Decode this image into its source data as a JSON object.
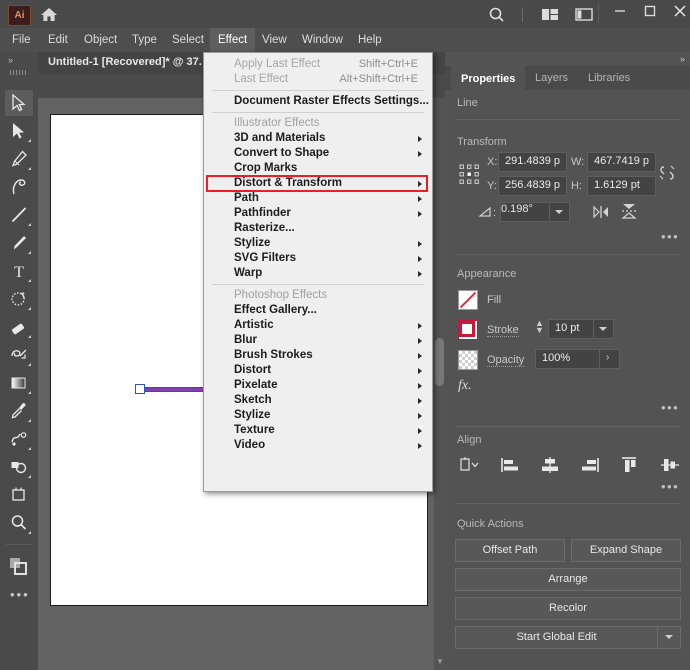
{
  "app": {
    "logo_text": "Ai",
    "home_icon": "home-icon",
    "search_icon": "search-icon",
    "arrange_documents_icon": "arrange-documents-icon",
    "workspace_switcher_icon": "workspace-switcher-icon",
    "minimize_label": "–",
    "maximize_label": "□",
    "close_label": "✕"
  },
  "menubar": {
    "items": [
      {
        "label": "File",
        "active": false
      },
      {
        "label": "Edit",
        "active": false
      },
      {
        "label": "Object",
        "active": false
      },
      {
        "label": "Type",
        "active": false
      },
      {
        "label": "Select",
        "active": false
      },
      {
        "label": "Effect",
        "active": true
      },
      {
        "label": "View",
        "active": false
      },
      {
        "label": "Window",
        "active": false
      },
      {
        "label": "Help",
        "active": false
      }
    ]
  },
  "document": {
    "tab_title": "Untitled-1 [Recovered]* @ 37.",
    "collapse_icon": "»"
  },
  "toolbar": {
    "collapse_icon": "»",
    "edit_toolbar_icon": "•••",
    "tools": [
      {
        "name": "selection-tool",
        "selected": true
      },
      {
        "name": "direct-selection-tool",
        "selected": false
      },
      {
        "name": "pen-tool",
        "selected": false
      },
      {
        "name": "curvature-tool",
        "selected": false
      },
      {
        "name": "line-segment-tool",
        "selected": false
      },
      {
        "name": "paintbrush-tool",
        "selected": false
      },
      {
        "name": "type-tool",
        "selected": false
      },
      {
        "name": "rotate-tool",
        "selected": false
      },
      {
        "name": "eraser-tool",
        "selected": false
      },
      {
        "name": "scale-tool",
        "selected": false
      },
      {
        "name": "gradient-tool",
        "selected": false
      },
      {
        "name": "eyedropper-tool",
        "selected": false
      },
      {
        "name": "blend-tool",
        "selected": false
      },
      {
        "name": "shape-builder-tool",
        "selected": false
      },
      {
        "name": "artboard-tool",
        "selected": false
      },
      {
        "name": "zoom-tool",
        "selected": false
      }
    ]
  },
  "effect_menu": {
    "rows": [
      {
        "kind": "item",
        "label": "Apply Last Effect",
        "shortcut": "Shift+Ctrl+E",
        "disabled": true,
        "submenu": false
      },
      {
        "kind": "item",
        "label": "Last Effect",
        "shortcut": "Alt+Shift+Ctrl+E",
        "disabled": true,
        "submenu": false
      },
      {
        "kind": "separator"
      },
      {
        "kind": "item",
        "label": "Document Raster Effects Settings...",
        "shortcut": "",
        "disabled": false,
        "submenu": false
      },
      {
        "kind": "separator"
      },
      {
        "kind": "header",
        "label": "Illustrator Effects"
      },
      {
        "kind": "item",
        "label": "3D and Materials",
        "shortcut": "",
        "disabled": false,
        "submenu": true
      },
      {
        "kind": "item",
        "label": "Convert to Shape",
        "shortcut": "",
        "disabled": false,
        "submenu": true
      },
      {
        "kind": "item",
        "label": "Crop Marks",
        "shortcut": "",
        "disabled": false,
        "submenu": false
      },
      {
        "kind": "item",
        "label": "Distort & Transform",
        "shortcut": "",
        "disabled": false,
        "submenu": true,
        "highlighted": true
      },
      {
        "kind": "item",
        "label": "Path",
        "shortcut": "",
        "disabled": false,
        "submenu": true
      },
      {
        "kind": "item",
        "label": "Pathfinder",
        "shortcut": "",
        "disabled": false,
        "submenu": true
      },
      {
        "kind": "item",
        "label": "Rasterize...",
        "shortcut": "",
        "disabled": false,
        "submenu": false
      },
      {
        "kind": "item",
        "label": "Stylize",
        "shortcut": "",
        "disabled": false,
        "submenu": true
      },
      {
        "kind": "item",
        "label": "SVG Filters",
        "shortcut": "",
        "disabled": false,
        "submenu": true
      },
      {
        "kind": "item",
        "label": "Warp",
        "shortcut": "",
        "disabled": false,
        "submenu": true
      },
      {
        "kind": "separator"
      },
      {
        "kind": "header",
        "label": "Photoshop Effects"
      },
      {
        "kind": "item",
        "label": "Effect Gallery...",
        "shortcut": "",
        "disabled": false,
        "submenu": false
      },
      {
        "kind": "item",
        "label": "Artistic",
        "shortcut": "",
        "disabled": false,
        "submenu": true
      },
      {
        "kind": "item",
        "label": "Blur",
        "shortcut": "",
        "disabled": false,
        "submenu": true
      },
      {
        "kind": "item",
        "label": "Brush Strokes",
        "shortcut": "",
        "disabled": false,
        "submenu": true
      },
      {
        "kind": "item",
        "label": "Distort",
        "shortcut": "",
        "disabled": false,
        "submenu": true
      },
      {
        "kind": "item",
        "label": "Pixelate",
        "shortcut": "",
        "disabled": false,
        "submenu": true
      },
      {
        "kind": "item",
        "label": "Sketch",
        "shortcut": "",
        "disabled": false,
        "submenu": true
      },
      {
        "kind": "item",
        "label": "Stylize",
        "shortcut": "",
        "disabled": false,
        "submenu": true
      },
      {
        "kind": "item",
        "label": "Texture",
        "shortcut": "",
        "disabled": false,
        "submenu": true
      },
      {
        "kind": "item",
        "label": "Video",
        "shortcut": "",
        "disabled": false,
        "submenu": true
      }
    ],
    "highlight_color": "#ee1c25"
  },
  "properties": {
    "collapse_icon": "»",
    "tabs": [
      {
        "label": "Properties",
        "active": true
      },
      {
        "label": "Layers",
        "active": false
      },
      {
        "label": "Libraries",
        "active": false
      }
    ],
    "selection_label": "Line",
    "transform": {
      "title": "Transform",
      "x_label": "X:",
      "x_value": "291.4839 p",
      "y_label": "Y:",
      "y_value": "256.4839 p",
      "w_label": "W:",
      "w_value": "467.7419 p",
      "h_label": "H:",
      "h_value": "1.6129 pt",
      "angle_value": "0.198°",
      "link_icon": "unlink-proportions-icon",
      "flip_horizontal_icon": "flip-horizontal-icon",
      "flip_vertical_icon": "flip-vertical-icon",
      "more_options_icon": "•••"
    },
    "appearance": {
      "title": "Appearance",
      "fill_label": "Fill",
      "fill_swatch": "none-red-slash",
      "stroke_label": "Stroke",
      "stroke_color": "#c21b3c",
      "stroke_weight": "10 pt",
      "opacity_label": "Opacity",
      "opacity_value": "100%",
      "fx_label": "fx.",
      "more_options_icon": "•••"
    },
    "align": {
      "title": "Align",
      "buttons": [
        {
          "name": "align-to-selection-icon"
        },
        {
          "name": "align-left-icon"
        },
        {
          "name": "align-horizontal-center-icon"
        },
        {
          "name": "align-right-icon"
        },
        {
          "name": "align-top-icon"
        },
        {
          "name": "align-vertical-center-icon"
        },
        {
          "name": "align-bottom-icon"
        }
      ],
      "more_options_icon": "•••"
    },
    "quick_actions": {
      "title": "Quick Actions",
      "offset_path": "Offset Path",
      "expand_shape": "Expand Shape",
      "arrange": "Arrange",
      "recolor": "Recolor",
      "start_global_edit": "Start Global Edit"
    }
  }
}
